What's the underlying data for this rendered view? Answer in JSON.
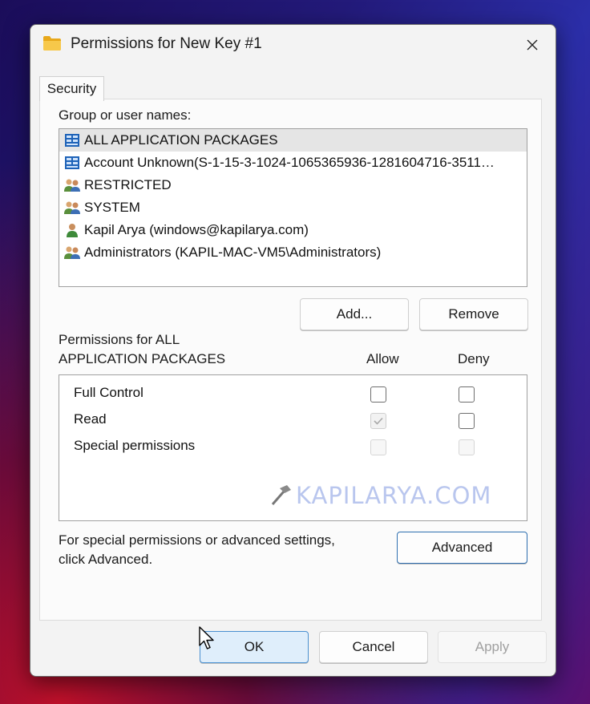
{
  "window": {
    "title": "Permissions for New Key #1"
  },
  "tabs": [
    {
      "label": "Security"
    }
  ],
  "users_section": {
    "label": "Group or user names:",
    "items": [
      {
        "name": "ALL APPLICATION PACKAGES",
        "icon": "app-packages-icon",
        "selected": true
      },
      {
        "name": "Account Unknown(S-1-15-3-1024-1065365936-1281604716-3511…",
        "icon": "app-packages-icon",
        "selected": false
      },
      {
        "name": "RESTRICTED",
        "icon": "group-icon",
        "selected": false
      },
      {
        "name": "SYSTEM",
        "icon": "group-icon",
        "selected": false
      },
      {
        "name": "Kapil Arya (windows@kapilarya.com)",
        "icon": "user-icon",
        "selected": false
      },
      {
        "name": "Administrators (KAPIL-MAC-VM5\\Administrators)",
        "icon": "group-icon",
        "selected": false
      }
    ],
    "add_label": "Add...",
    "remove_label": "Remove"
  },
  "permissions_section": {
    "label_line1": "Permissions for ALL",
    "label_line2": "APPLICATION PACKAGES",
    "allow_header": "Allow",
    "deny_header": "Deny",
    "rows": [
      {
        "name": "Full Control",
        "allow": false,
        "deny": false,
        "enabled": true
      },
      {
        "name": "Read",
        "allow": true,
        "deny": false,
        "enabled": true
      },
      {
        "name": "Special permissions",
        "allow": false,
        "deny": false,
        "enabled": false
      }
    ]
  },
  "watermark": "KAPILARYA.COM",
  "advanced": {
    "text_line1": "For special permissions or advanced settings,",
    "text_line2": "click Advanced.",
    "button_label": "Advanced"
  },
  "footer": {
    "ok_label": "OK",
    "cancel_label": "Cancel",
    "apply_label": "Apply"
  },
  "colors": {
    "accent": "#4a90d0",
    "selected_row": "#e5e5e5",
    "disabled_text": "#a0a0a0"
  }
}
